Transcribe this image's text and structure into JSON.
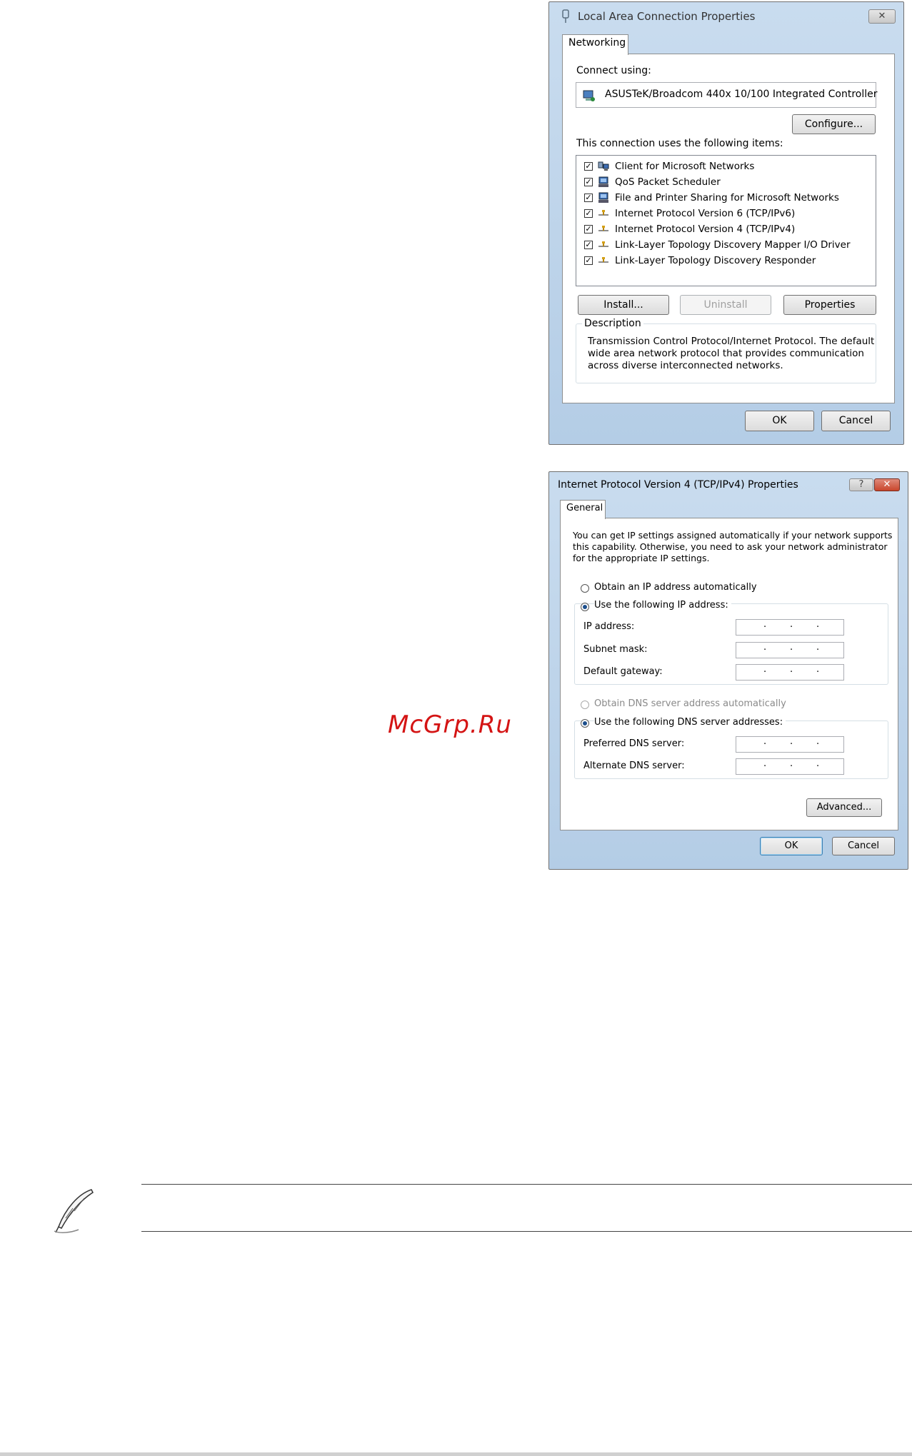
{
  "dialog1": {
    "title": "Local Area Connection Properties",
    "close_glyph": "✕",
    "tab": "Networking",
    "connect_using_label": "Connect using:",
    "adapter": "ASUSTeK/Broadcom 440x 10/100 Integrated Controller",
    "configure_button": "Configure...",
    "items_label": "This connection uses the following items:",
    "items": [
      {
        "label": "Client for Microsoft Networks",
        "checked": true,
        "icon": "network-client-icon"
      },
      {
        "label": "QoS Packet Scheduler",
        "checked": true,
        "icon": "network-service-icon"
      },
      {
        "label": "File and Printer Sharing for Microsoft Networks",
        "checked": true,
        "icon": "network-service-icon"
      },
      {
        "label": "Internet Protocol Version 6 (TCP/IPv6)",
        "checked": true,
        "icon": "protocol-icon"
      },
      {
        "label": "Internet Protocol Version 4 (TCP/IPv4)",
        "checked": true,
        "icon": "protocol-icon"
      },
      {
        "label": "Link-Layer Topology Discovery Mapper I/O Driver",
        "checked": true,
        "icon": "protocol-icon"
      },
      {
        "label": "Link-Layer Topology Discovery Responder",
        "checked": true,
        "icon": "protocol-icon"
      }
    ],
    "install_button": "Install...",
    "uninstall_button": "Uninstall",
    "properties_button": "Properties",
    "description_label": "Description",
    "description_lines": [
      "Transmission Control Protocol/Internet Protocol. The default",
      "wide area network protocol that provides communication",
      "across diverse interconnected networks."
    ],
    "ok_button": "OK",
    "cancel_button": "Cancel"
  },
  "dialog2": {
    "title": "Internet Protocol Version 4 (TCP/IPv4) Properties",
    "help_glyph": "?",
    "close_glyph": "✕",
    "tab": "General",
    "intro_lines": [
      "You can get IP settings assigned automatically if your network supports",
      "this capability. Otherwise, you need to ask your network administrator",
      "for the appropriate IP settings."
    ],
    "obtain_ip_auto": "Obtain an IP address automatically",
    "use_following_ip": "Use the following IP address:",
    "ip_address_label": "IP address:",
    "subnet_mask_label": "Subnet mask:",
    "default_gateway_label": "Default gateway:",
    "obtain_dns_auto": "Obtain DNS server address automatically",
    "use_following_dns": "Use the following DNS server addresses:",
    "preferred_dns_label": "Preferred DNS server:",
    "alternate_dns_label": "Alternate DNS server:",
    "advanced_button": "Advanced...",
    "ok_button": "OK",
    "cancel_button": "Cancel"
  },
  "watermark": "McGrp.Ru",
  "colors": {
    "watermark": "#d41414",
    "title_bar": "#c9dcef",
    "close_button_active": "#c9462c"
  }
}
